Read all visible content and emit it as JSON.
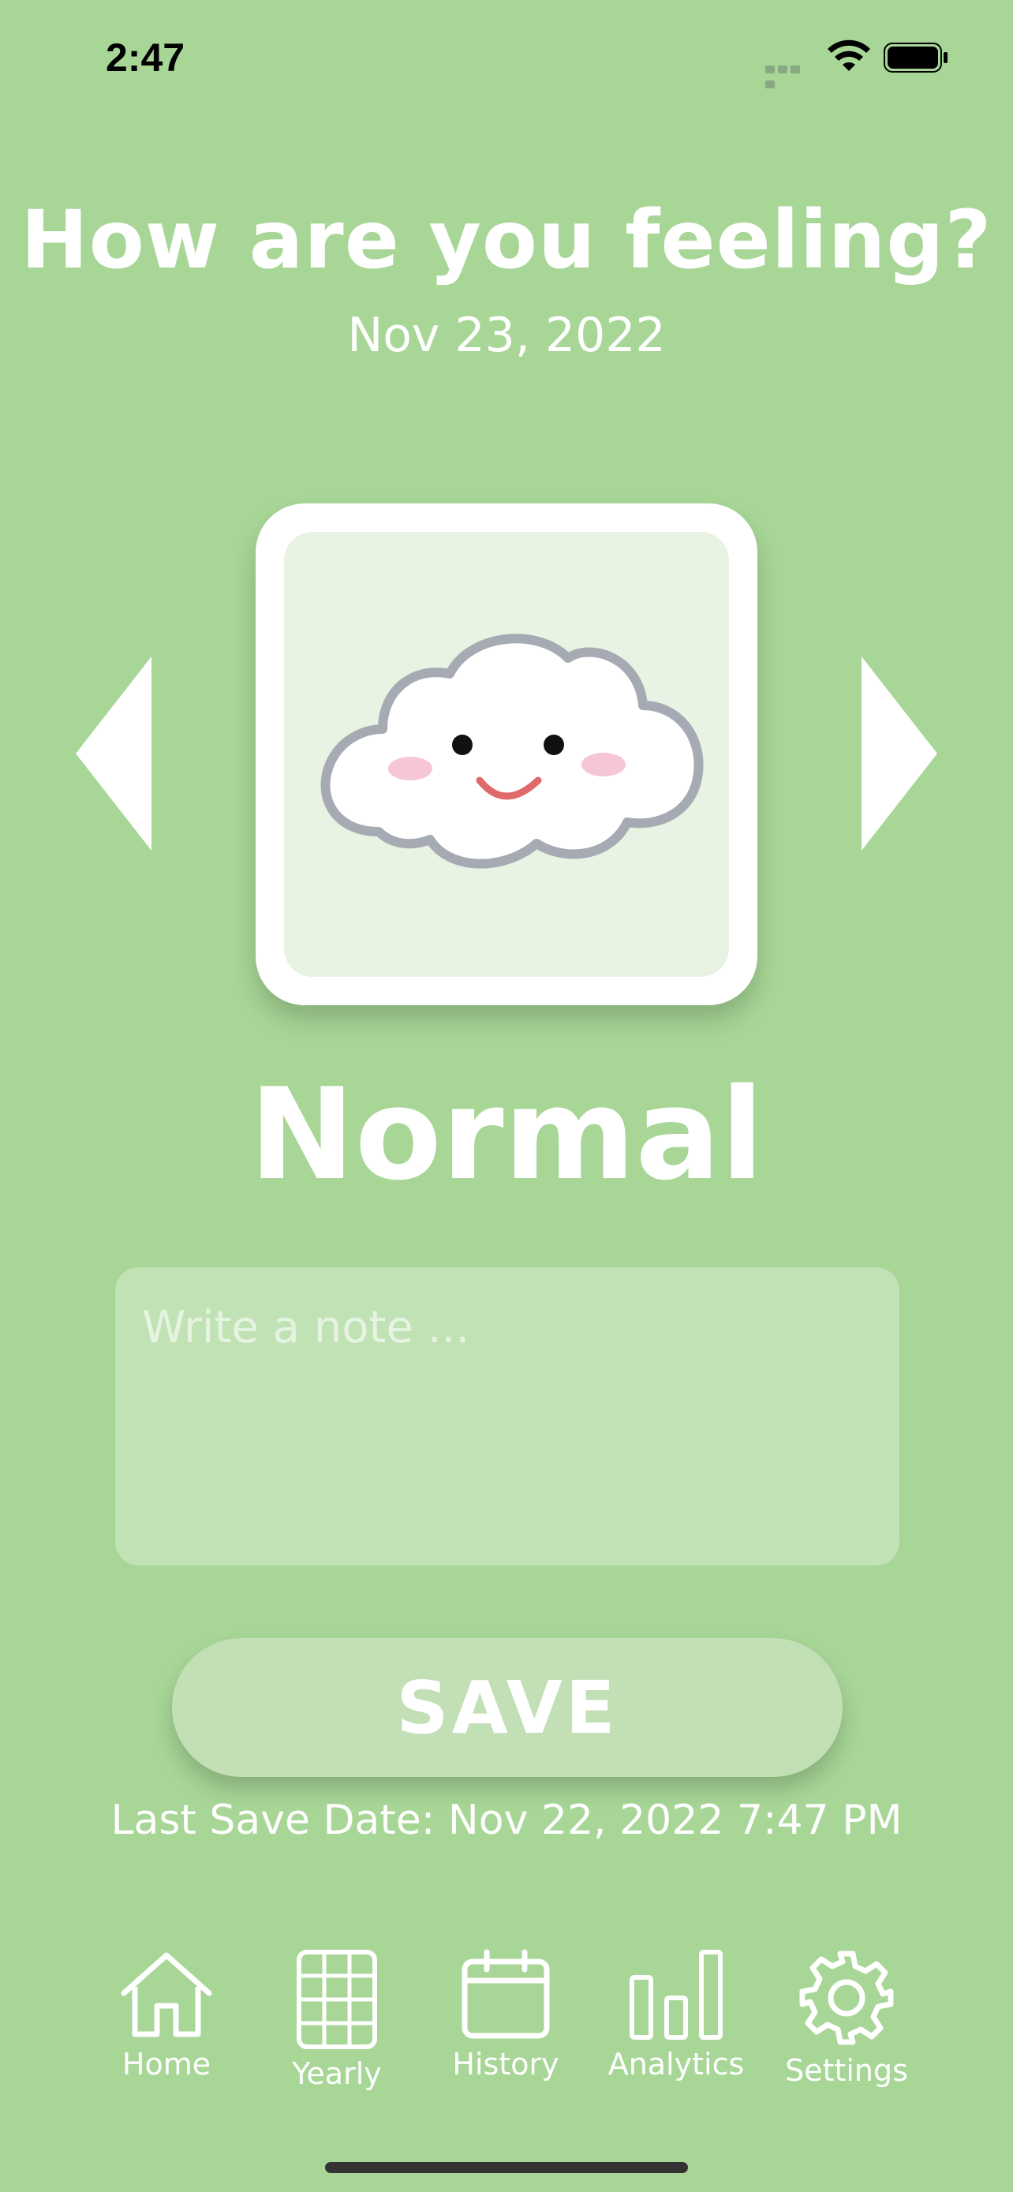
{
  "status_bar": {
    "time": "2:47"
  },
  "header": {
    "title": "How are you feeling?",
    "date": "Nov 23, 2022"
  },
  "mood": {
    "label": "Normal",
    "icon": "smiling-cloud-icon"
  },
  "note": {
    "placeholder": "Write a note ...",
    "value": ""
  },
  "save": {
    "label": "SAVE",
    "last_save": "Last Save Date: Nov 22, 2022 7:47 PM"
  },
  "tabs": [
    {
      "label": "Home",
      "icon": "home-icon"
    },
    {
      "label": "Yearly",
      "icon": "grid-icon"
    },
    {
      "label": "History",
      "icon": "calendar-icon"
    },
    {
      "label": "Analytics",
      "icon": "bar-chart-icon"
    },
    {
      "label": "Settings",
      "icon": "gear-icon"
    }
  ],
  "colors": {
    "background": "#a7d696",
    "card": "#ffffff",
    "card_inner": "#e8f3e3",
    "button": "#c2dfb5"
  }
}
